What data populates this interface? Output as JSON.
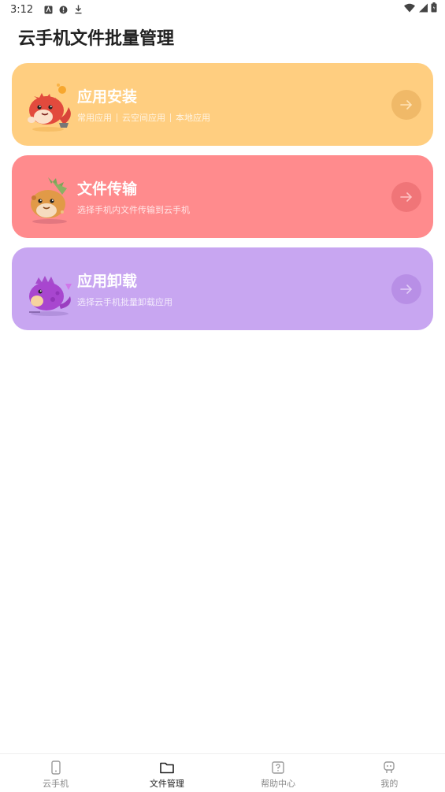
{
  "status_bar": {
    "time": "3:12"
  },
  "page": {
    "title": "云手机文件批量管理"
  },
  "cards": [
    {
      "title": "应用安装",
      "subs": [
        "常用应用",
        "云空间应用",
        "本地应用"
      ],
      "color": "#FFCE80"
    },
    {
      "title": "文件传输",
      "subs": [
        "选择手机内文件传输到云手机"
      ],
      "color": "#FF8B8D"
    },
    {
      "title": "应用卸载",
      "subs": [
        "选择云手机批量卸载应用"
      ],
      "color": "#C8A6F1"
    }
  ],
  "tabs": [
    {
      "label": "云手机",
      "icon": "phone-icon",
      "active": false
    },
    {
      "label": "文件管理",
      "icon": "folder-icon",
      "active": true
    },
    {
      "label": "帮助中心",
      "icon": "help-icon",
      "active": false
    },
    {
      "label": "我的",
      "icon": "profile-icon",
      "active": false
    }
  ]
}
